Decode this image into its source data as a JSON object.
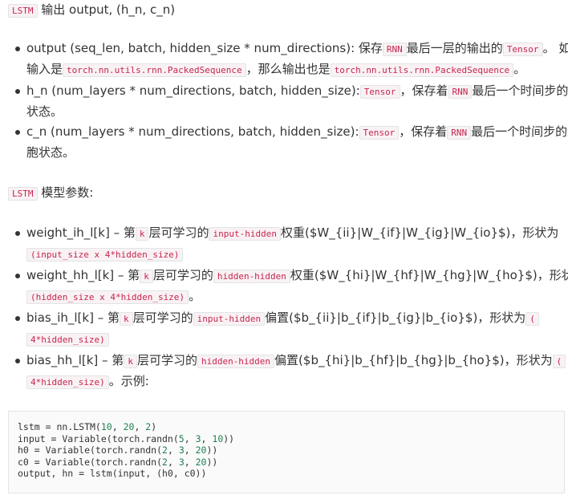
{
  "section1": {
    "code": "LSTM",
    "title": "输出 output, (h_n, c_n)"
  },
  "outputs": [
    {
      "r1_text": "output (seq_len, batch, hidden_size * num_directions): 保存",
      "r1_code1": "RNN",
      "r1_text2": "最后一层的输出的",
      "r1_code2": "Tensor",
      "r1_text3": "。 如果",
      "r2_text": "输入是",
      "r2_code1": "torch.nn.utils.rnn.PackedSequence",
      "r2_text2": "，那么输出也是",
      "r2_code2": "torch.nn.utils.rnn.PackedSequence",
      "r2_text3": "。"
    },
    {
      "r1_text": "h_n (num_layers * num_directions, batch, hidden_size):",
      "r1_code1": "Tensor",
      "r1_text2": "，保存着",
      "r1_code2": "RNN",
      "r1_text3": "最后一个时间步的隐",
      "r2_text": "状态。"
    },
    {
      "r1_text": "c_n (num_layers * num_directions, batch, hidden_size):",
      "r1_code1": "Tensor",
      "r1_text2": "，保存着",
      "r1_code2": "RNN",
      "r1_text3": "最后一个时间步的细",
      "r2_text": "胞状态。"
    }
  ],
  "section2": {
    "code": "LSTM",
    "title": "模型参数:"
  },
  "params": [
    {
      "r1_text": "weight_ih_l[k] – 第",
      "r1_code1": "k",
      "r1_text2": "层可学习的",
      "r1_code2": "input-hidden",
      "r1_text3": "权重($W_{ii}|W_{if}|W_{ig}|W_{io}$)，形状为",
      "r2_code": "(input_size x 4*hidden_size)",
      "r2_text": ""
    },
    {
      "r1_text": "weight_hh_l[k] – 第",
      "r1_code1": "k",
      "r1_text2": "层可学习的",
      "r1_code2": "hidden-hidden",
      "r1_text3": "权重($W_{hi}|W_{hf}|W_{hg}|W_{ho}$)，形状为",
      "r2_code": "(hidden_size x 4*hidden_size)",
      "r2_text": "。"
    },
    {
      "r1_text": "bias_ih_l[k] – 第",
      "r1_code1": "k",
      "r1_text2": "层可学习的",
      "r1_code2": "input-hidden",
      "r1_text3": "偏置($b_{ii}|b_{if}|b_{ig}|b_{io}$)，形状为",
      "r1_code3": "(",
      "r2_code": "4*hidden_size)",
      "r2_text": ""
    },
    {
      "r1_text": "bias_hh_l[k] – 第",
      "r1_code1": "k",
      "r1_text2": "层可学习的",
      "r1_code2": "hidden-hidden",
      "r1_text3": "偏置($b_{hi}|b_{hf}|b_{hg}|b_{ho}$)，形状为",
      "r1_code3": "(",
      "r2_code": "4*hidden_size)",
      "r2_text": "。示例:"
    }
  ],
  "code_block": {
    "line1_a": "lstm = nn.LSTM(",
    "line1_n1": "10",
    "line1_s1": ", ",
    "line1_n2": "20",
    "line1_s2": ", ",
    "line1_n3": "2",
    "line1_e": ")",
    "line2_a": "input = Variable(torch.randn(",
    "line2_n1": "5",
    "line2_n2": "3",
    "line2_n3": "10",
    "line2_e": "))",
    "line3_a": "h0 = Variable(torch.randn(",
    "line3_n1": "2",
    "line3_n2": "3",
    "line3_n3": "20",
    "line3_e": "))",
    "line4_a": "c0 = Variable(torch.randn(",
    "line4_n1": "2",
    "line4_n2": "3",
    "line4_n3": "20",
    "line4_e": "))",
    "line5": "output, hn = lstm(input, (h0, c0))",
    "sep": ", "
  },
  "colors": {
    "code_text": "#c7254e",
    "code_bg": "#f9f2f4",
    "number": "#208050"
  }
}
